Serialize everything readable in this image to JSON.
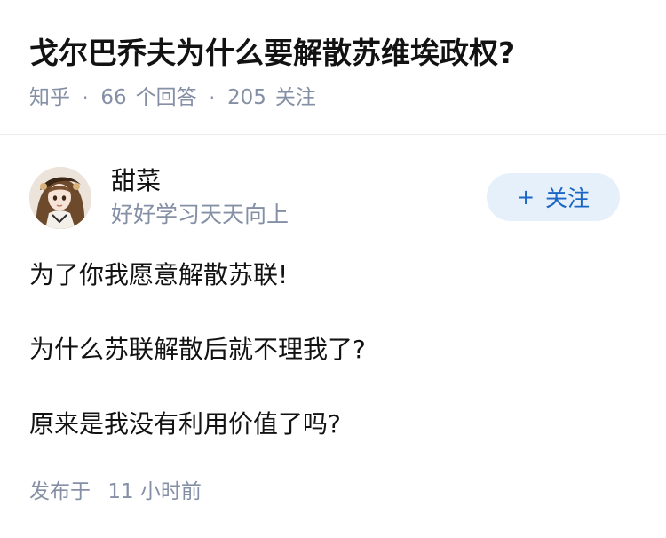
{
  "question": {
    "title": "戈尔巴乔夫为什么要解散苏维埃政权?",
    "source": "知乎",
    "answer_count": "66",
    "answer_label": "个回答",
    "follow_count": "205",
    "follow_label": "关注"
  },
  "author": {
    "avatar_icon": "anime-girl-avatar",
    "name": "甜菜",
    "bio": "好好学习天天向上",
    "follow_button_label": "关注",
    "follow_icon": "plus-icon"
  },
  "answer": {
    "paragraphs": [
      "为了你我愿意解散苏联!",
      "为什么苏联解散后就不理我了?",
      "原来是我没有利用价值了吗?"
    ]
  },
  "footer": {
    "publish_prefix": "发布于",
    "publish_time": "11 小时前"
  },
  "colors": {
    "text_primary": "#121212",
    "text_secondary": "#8590a6",
    "accent": "#1a66c5",
    "accent_bg": "#e5f0fb"
  }
}
